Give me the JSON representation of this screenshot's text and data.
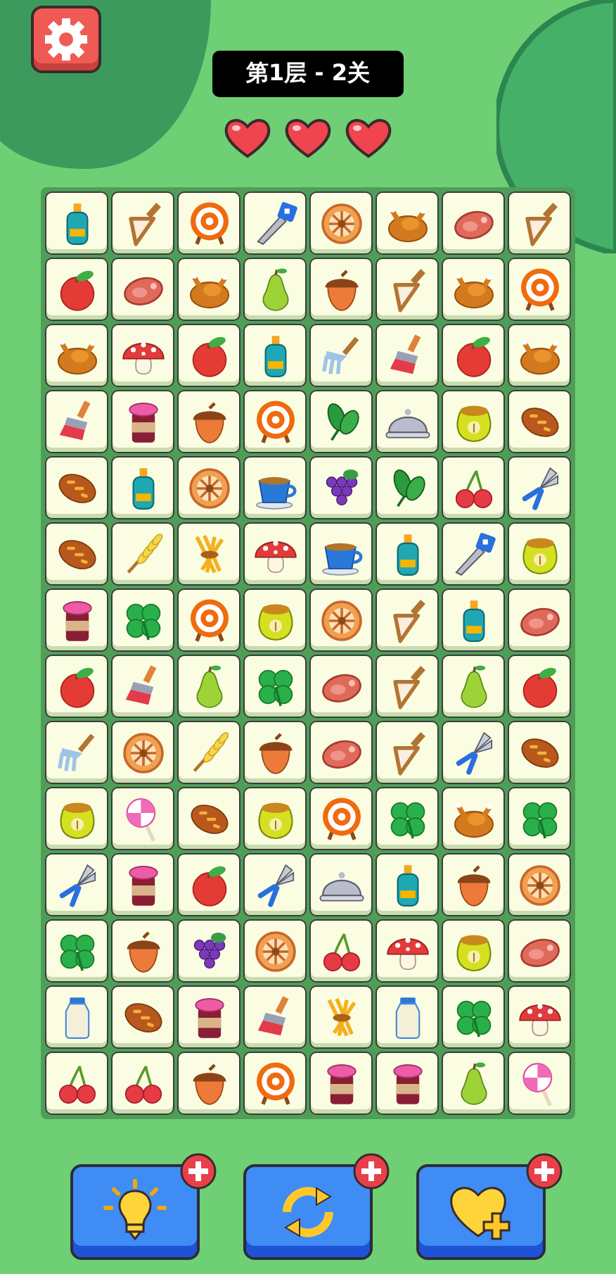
{
  "level_label": "第1层 - 2关",
  "hearts": [
    {
      "filled": true
    },
    {
      "filled": true
    },
    {
      "filled": true
    }
  ],
  "board": {
    "rows": [
      {
        "tiles": [
          {
            "kind": "bottle"
          },
          {
            "kind": "scoop"
          },
          {
            "kind": "target"
          },
          {
            "kind": "saw"
          },
          {
            "kind": "wheel"
          },
          {
            "kind": "roast-chicken"
          },
          {
            "kind": "steak"
          },
          {
            "kind": "scoop"
          }
        ]
      },
      {
        "tiles": [
          {
            "kind": "apple"
          },
          {
            "kind": "steak"
          },
          {
            "kind": "roast-chicken"
          },
          {
            "kind": "pear"
          },
          {
            "kind": "acorn"
          },
          {
            "kind": "scoop"
          },
          {
            "kind": "roast-chicken"
          },
          {
            "kind": "target"
          }
        ]
      },
      {
        "tiles": [
          {
            "kind": "roast-chicken"
          },
          {
            "kind": "mushroom"
          },
          {
            "kind": "apple"
          },
          {
            "kind": "bottle"
          },
          {
            "kind": "rake"
          },
          {
            "kind": "brush"
          },
          {
            "kind": "apple"
          },
          {
            "kind": "roast-chicken"
          }
        ]
      },
      {
        "tiles": [
          {
            "kind": "brush"
          },
          {
            "kind": "jam-jar"
          },
          {
            "kind": "acorn"
          },
          {
            "kind": "target"
          },
          {
            "kind": "spinach"
          },
          {
            "kind": "cloche"
          },
          {
            "kind": "seed-bag"
          },
          {
            "kind": "bread"
          }
        ]
      },
      {
        "tiles": [
          {
            "kind": "bread"
          },
          {
            "kind": "bottle"
          },
          {
            "kind": "wheel"
          },
          {
            "kind": "teacup"
          },
          {
            "kind": "grapes"
          },
          {
            "kind": "spinach"
          },
          {
            "kind": "cherries"
          },
          {
            "kind": "pliers"
          }
        ]
      },
      {
        "tiles": [
          {
            "kind": "bread"
          },
          {
            "kind": "wheat"
          },
          {
            "kind": "wheat-bundle"
          },
          {
            "kind": "mushroom"
          },
          {
            "kind": "teacup"
          },
          {
            "kind": "bottle"
          },
          {
            "kind": "saw"
          },
          {
            "kind": "seed-bag"
          }
        ]
      },
      {
        "tiles": [
          {
            "kind": "jam-jar"
          },
          {
            "kind": "clover"
          },
          {
            "kind": "target"
          },
          {
            "kind": "seed-bag"
          },
          {
            "kind": "wheel"
          },
          {
            "kind": "scoop"
          },
          {
            "kind": "bottle"
          },
          {
            "kind": "steak"
          }
        ]
      },
      {
        "tiles": [
          {
            "kind": "apple"
          },
          {
            "kind": "brush"
          },
          {
            "kind": "pear"
          },
          {
            "kind": "clover"
          },
          {
            "kind": "steak"
          },
          {
            "kind": "scoop"
          },
          {
            "kind": "pear"
          },
          {
            "kind": "apple"
          }
        ]
      },
      {
        "tiles": [
          {
            "kind": "rake"
          },
          {
            "kind": "wheel"
          },
          {
            "kind": "wheat"
          },
          {
            "kind": "acorn"
          },
          {
            "kind": "steak"
          },
          {
            "kind": "scoop"
          },
          {
            "kind": "pliers"
          },
          {
            "kind": "bread"
          }
        ]
      },
      {
        "tiles": [
          {
            "kind": "seed-bag"
          },
          {
            "kind": "lollipop"
          },
          {
            "kind": "bread"
          },
          {
            "kind": "seed-bag"
          },
          {
            "kind": "target"
          },
          {
            "kind": "clover"
          },
          {
            "kind": "roast-chicken"
          },
          {
            "kind": "clover"
          }
        ]
      },
      {
        "tiles": [
          {
            "kind": "pliers"
          },
          {
            "kind": "jam-jar"
          },
          {
            "kind": "apple"
          },
          {
            "kind": "pliers"
          },
          {
            "kind": "cloche"
          },
          {
            "kind": "bottle"
          },
          {
            "kind": "acorn"
          },
          {
            "kind": "wheel"
          }
        ]
      },
      {
        "tiles": [
          {
            "kind": "clover"
          },
          {
            "kind": "acorn"
          },
          {
            "kind": "grapes"
          },
          {
            "kind": "wheel"
          },
          {
            "kind": "cherries"
          },
          {
            "kind": "mushroom"
          },
          {
            "kind": "seed-bag"
          },
          {
            "kind": "steak"
          }
        ]
      },
      {
        "tiles": [
          {
            "kind": "milk-bottle"
          },
          {
            "kind": "bread"
          },
          {
            "kind": "jam-jar"
          },
          {
            "kind": "brush"
          },
          {
            "kind": "wheat-bundle"
          },
          {
            "kind": "milk-bottle"
          },
          {
            "kind": "clover"
          },
          {
            "kind": "mushroom"
          }
        ]
      },
      {
        "tiles": [
          {
            "kind": "cherries"
          },
          {
            "kind": "cherries"
          },
          {
            "kind": "acorn"
          },
          {
            "kind": "target"
          },
          {
            "kind": "jam-jar"
          },
          {
            "kind": "jam-jar"
          },
          {
            "kind": "pear"
          },
          {
            "kind": "lollipop"
          }
        ]
      }
    ]
  },
  "tools": [
    {
      "kind": "hint"
    },
    {
      "kind": "shuffle"
    },
    {
      "kind": "extra-life"
    }
  ]
}
